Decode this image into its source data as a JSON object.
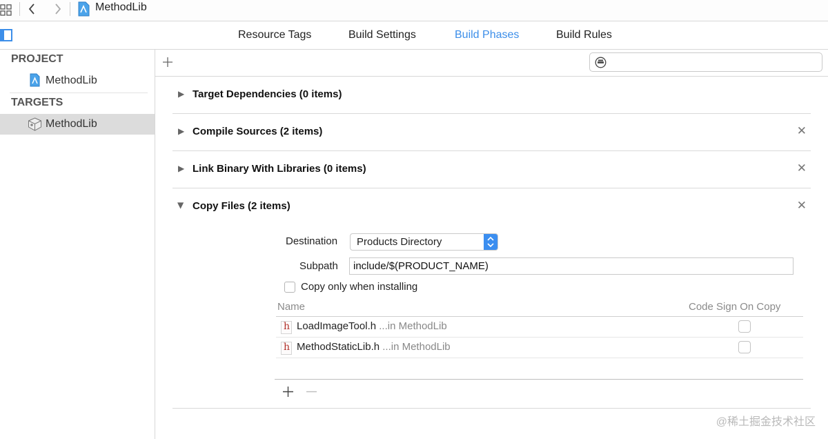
{
  "window": {
    "title": "MethodLib"
  },
  "tabs": [
    {
      "label": "Resource Tags",
      "active": false
    },
    {
      "label": "Build Settings",
      "active": false
    },
    {
      "label": "Build Phases",
      "active": true
    },
    {
      "label": "Build Rules",
      "active": false
    }
  ],
  "sidebar": {
    "project_header": "PROJECT",
    "project_item": "MethodLib",
    "targets_header": "TARGETS",
    "target_item": "MethodLib"
  },
  "phases": [
    {
      "title": "Target Dependencies (0 items)",
      "expanded": false,
      "deletable": false
    },
    {
      "title": "Compile Sources (2 items)",
      "expanded": false,
      "deletable": true
    },
    {
      "title": "Link Binary With Libraries (0 items)",
      "expanded": false,
      "deletable": true
    },
    {
      "title": "Copy Files (2 items)",
      "expanded": true,
      "deletable": true
    }
  ],
  "copy_files": {
    "destination_label": "Destination",
    "destination_value": "Products Directory",
    "subpath_label": "Subpath",
    "subpath_value": "include/$(PRODUCT_NAME)",
    "copy_only_label": "Copy only when installing",
    "copy_only_checked": false,
    "col_name": "Name",
    "col_code_sign": "Code Sign On Copy",
    "files": [
      {
        "name": "LoadImageTool.h",
        "location": "...in MethodLib",
        "code_sign": false
      },
      {
        "name": "MethodStaticLib.h",
        "location": "...in MethodLib",
        "code_sign": false
      }
    ]
  },
  "watermark": "@稀土掘金技术社区",
  "colors": {
    "accent": "#3c8ee9",
    "selection": "#dcdcdc",
    "header_file_glyph": "#b0302a"
  },
  "icons": [
    "grid-icon",
    "back-chevron-icon",
    "forward-chevron-icon",
    "project-file-icon",
    "sidebar-toggle-icon",
    "target-icon",
    "add-icon",
    "filter-icon",
    "disclosure-triangle-icon",
    "close-icon",
    "stepper-icon",
    "header-file-icon",
    "remove-icon"
  ]
}
